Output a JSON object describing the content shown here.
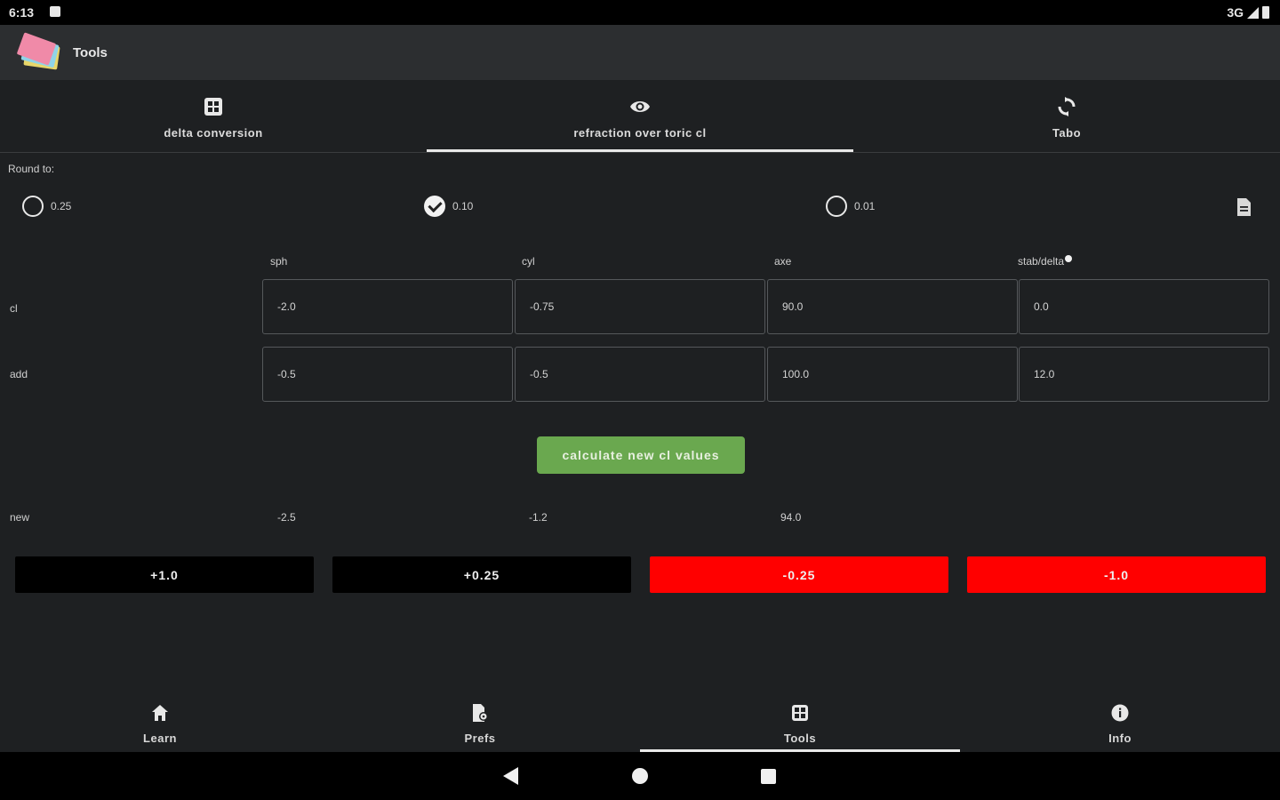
{
  "status_bar": {
    "time": "6:13",
    "network": "3G"
  },
  "app_bar": {
    "title": "Tools"
  },
  "tabs": [
    {
      "label": "delta conversion",
      "icon": "calculator-icon"
    },
    {
      "label": "refraction over toric cl",
      "icon": "eye-icon",
      "selected": true
    },
    {
      "label": "Tabo",
      "icon": "rotate-icon"
    }
  ],
  "round_to": {
    "label": "Round to:",
    "options": [
      "0.25",
      "0.10",
      "0.01"
    ],
    "selected": "0.10"
  },
  "columns": [
    "sph",
    "cyl",
    "axe",
    "stab/delta"
  ],
  "rows": {
    "cl": {
      "label": "cl",
      "values": [
        "-2.0",
        "-0.75",
        "90.0",
        "0.0"
      ]
    },
    "add": {
      "label": "add",
      "values": [
        "-0.5",
        "-0.5",
        "100.0",
        "12.0"
      ]
    }
  },
  "calculate_button": "calculate new cl values",
  "result": {
    "label": "new",
    "values": [
      "-2.5",
      "-1.2",
      "94.0"
    ]
  },
  "adjust_buttons": [
    "+1.0",
    "+0.25",
    "-0.25",
    "-1.0"
  ],
  "bottom_nav": [
    {
      "label": "Learn",
      "icon": "home-icon"
    },
    {
      "label": "Prefs",
      "icon": "prefs-icon"
    },
    {
      "label": "Tools",
      "icon": "calculator-icon",
      "selected": true
    },
    {
      "label": "Info",
      "icon": "info-icon"
    }
  ],
  "colors": {
    "accent_green": "#6aa84f",
    "danger_red": "#ff0000",
    "background": "#1e2022"
  }
}
